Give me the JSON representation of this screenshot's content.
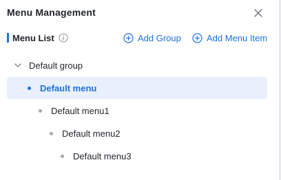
{
  "panel": {
    "title": "Menu Management",
    "close_icon": "close-icon"
  },
  "section": {
    "label": "Menu List",
    "info_icon": "info-circle-icon"
  },
  "actions": {
    "add_group": "Add Group",
    "add_menu_item": "Add Menu Item",
    "icon": "plus-circle-icon"
  },
  "tree": {
    "group": {
      "label": "Default group",
      "expanded": true,
      "icon": "chevron-down-icon"
    },
    "items": [
      {
        "label": "Default menu",
        "selected": true
      },
      {
        "label": "Default menu1",
        "selected": false
      },
      {
        "label": "Default menu2",
        "selected": false
      },
      {
        "label": "Default menu3",
        "selected": false
      }
    ]
  },
  "colors": {
    "accent": "#1e6fe8",
    "selected_bg": "#e8f0fc",
    "text": "#1f2329",
    "dot_inactive": "#a3a8b0"
  }
}
